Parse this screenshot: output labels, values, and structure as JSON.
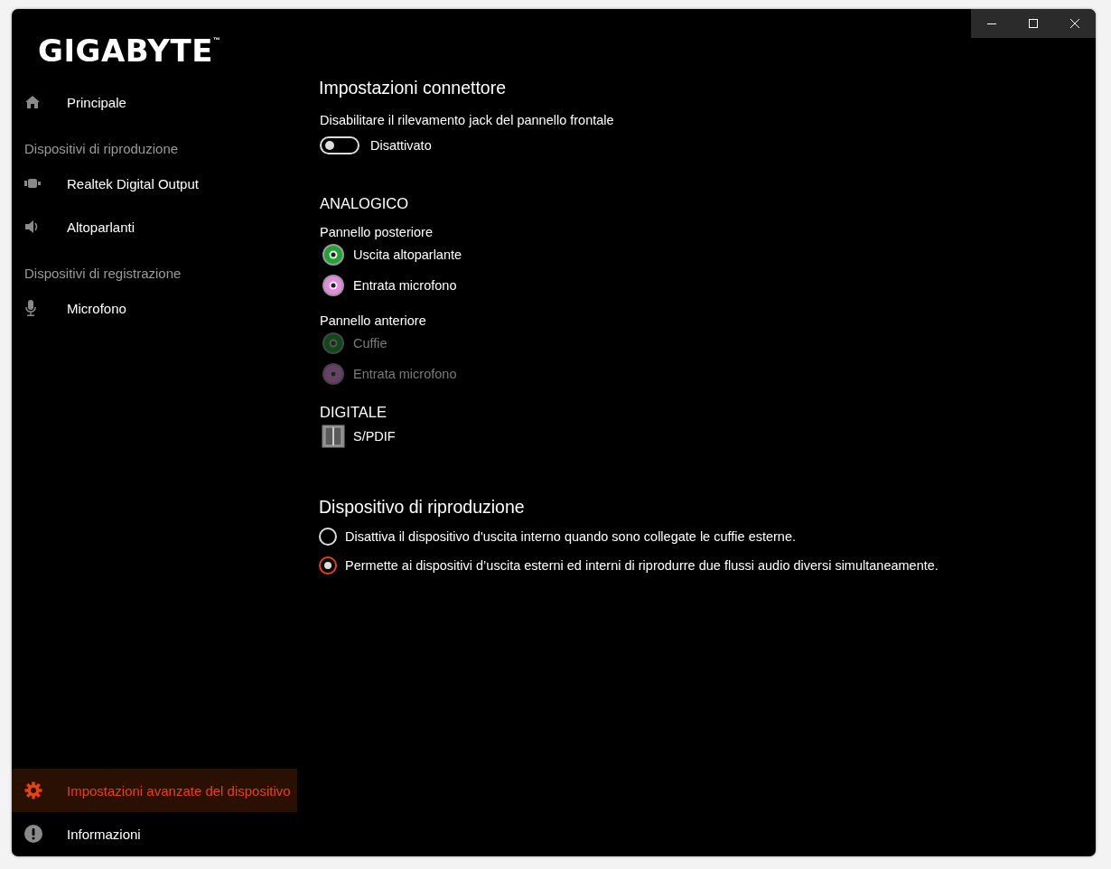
{
  "logo": {
    "text": "GIGABYTE",
    "trademark": "™"
  },
  "sidebar": {
    "items": [
      {
        "kind": "link",
        "label": "Principale",
        "selected": false
      },
      {
        "kind": "heading",
        "label": "Dispositivi di riproduzione"
      },
      {
        "kind": "link",
        "label": "Realtek Digital Output",
        "selected": false
      },
      {
        "kind": "link",
        "label": "Altoparlanti",
        "selected": false
      },
      {
        "kind": "heading",
        "label": "Dispositivi di registrazione"
      },
      {
        "kind": "link",
        "label": "Microfono",
        "selected": false
      }
    ],
    "footer_items": [
      {
        "label": "Impostazioni avanzate del dispositivo",
        "selected": true
      },
      {
        "label": "Informazioni",
        "selected": false
      }
    ]
  },
  "connector_settings": {
    "title": "Impostazioni connettore",
    "jack_detection": {
      "label": "Disabilitare il rilevamento jack del pannello frontale",
      "on": false,
      "state_text": "Disattivato"
    }
  },
  "analog": {
    "title": "ANALOGICO",
    "panels": [
      {
        "title": "Pannello posteriore",
        "jacks": [
          {
            "label": "Uscita altoparlante",
            "color": "#1fa332",
            "disabled": false
          },
          {
            "label": "Entrata microfono",
            "color": "#e68ae0",
            "disabled": false
          }
        ]
      },
      {
        "title": "Pannello anteriore",
        "jacks": [
          {
            "label": "Cuffie",
            "color": "#0e4a17",
            "disabled": true
          },
          {
            "label": "Entrata microfono",
            "color": "#6a3e68",
            "disabled": true
          }
        ]
      }
    ]
  },
  "digital": {
    "title": "DIGITALE",
    "ports": [
      {
        "label": "S/PDIF"
      }
    ]
  },
  "playback_device": {
    "title": "Dispositivo di riproduzione",
    "options": [
      {
        "label": "Disattiva il dispositivo d'uscita interno quando sono collegate le cuffie esterne.",
        "selected": false
      },
      {
        "label": "Permette ai dispositivi d’uscita esterni ed interni di riprodurre due flussi audio diversi simultaneamente.",
        "selected": true
      }
    ]
  }
}
